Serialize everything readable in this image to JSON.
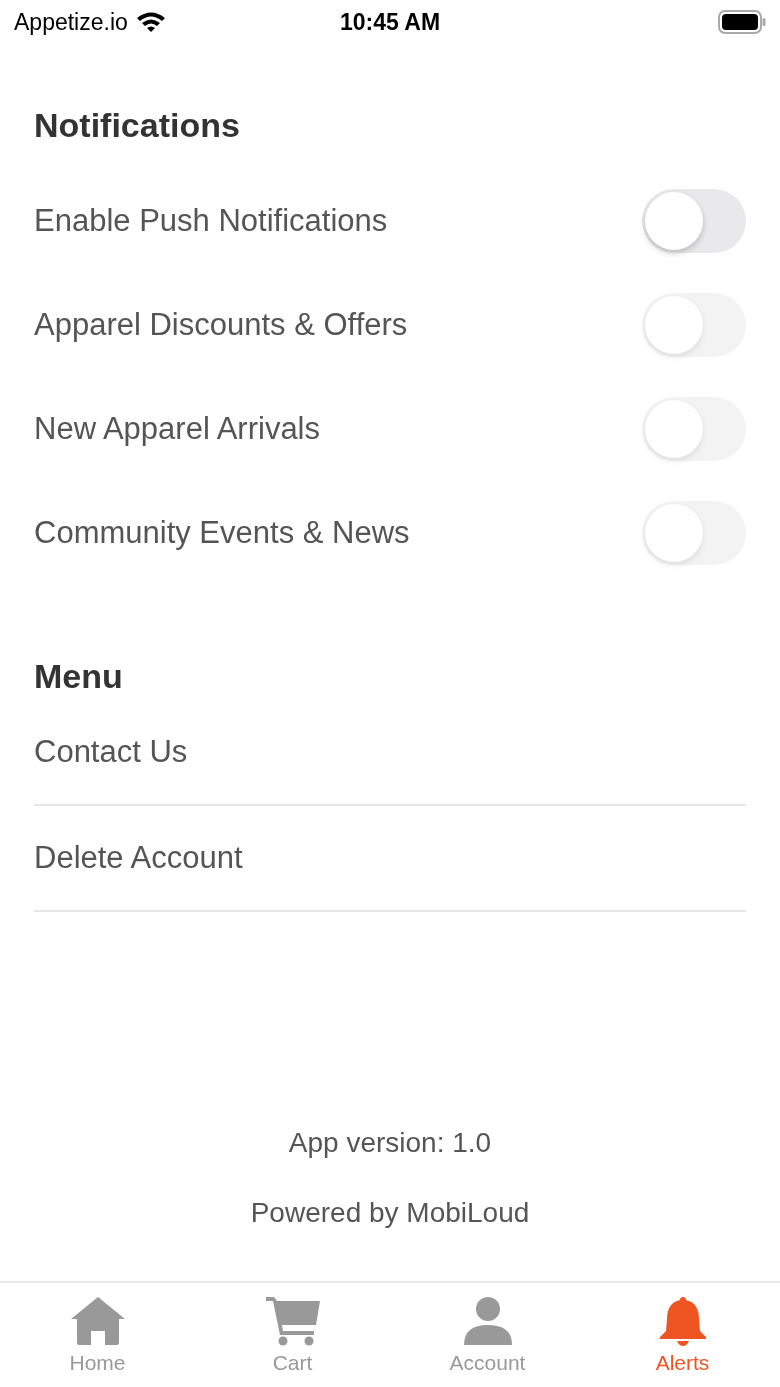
{
  "status_bar": {
    "carrier": "Appetize.io",
    "time": "10:45 AM"
  },
  "notifications": {
    "title": "Notifications",
    "items": [
      {
        "label": "Enable Push Notifications",
        "on": false,
        "disabled": false
      },
      {
        "label": "Apparel Discounts & Offers",
        "on": false,
        "disabled": true
      },
      {
        "label": "New Apparel Arrivals",
        "on": false,
        "disabled": true
      },
      {
        "label": "Community Events & News",
        "on": false,
        "disabled": true
      }
    ]
  },
  "menu": {
    "title": "Menu",
    "items": [
      "Contact Us",
      "Delete Account"
    ]
  },
  "footer": {
    "version": "App version: 1.0",
    "powered_by": "Powered by MobiLoud"
  },
  "tab_bar": [
    {
      "kind": "home",
      "label": "Home",
      "selected": false
    },
    {
      "kind": "cart",
      "label": "Cart",
      "selected": false
    },
    {
      "kind": "account",
      "label": "Account",
      "selected": false
    },
    {
      "kind": "alerts",
      "label": "Alerts",
      "selected": true
    }
  ]
}
